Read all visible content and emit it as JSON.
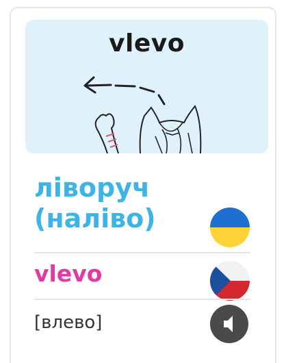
{
  "illustration": {
    "word": "vlevo"
  },
  "translation": {
    "ukrainian": "ліворуч\n(наліво)",
    "czech": "vlevo",
    "pronunciation": "[влево]"
  },
  "icons": {
    "ukraine_flag": "ukraine-flag-icon",
    "czech_flag": "czech-flag-icon",
    "speaker": "speaker-icon"
  },
  "colors": {
    "ukrainian_text": "#3cb4e7",
    "czech_text": "#e03aa3",
    "illustration_bg": "#dff1fa",
    "speaker_bg": "#4a4a4a"
  }
}
